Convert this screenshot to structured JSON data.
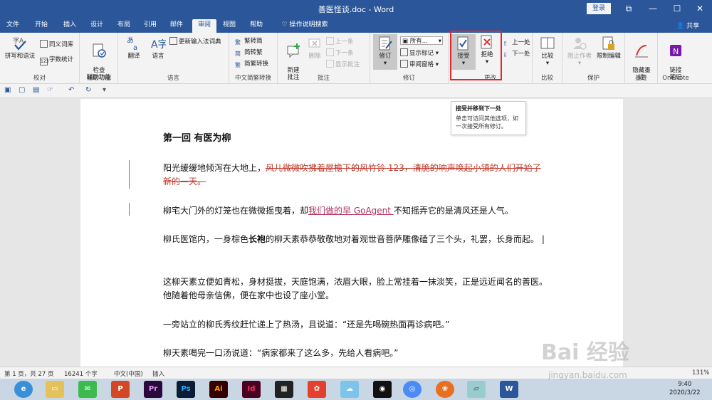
{
  "window": {
    "title": "善医怪谈.doc - Word",
    "login": "登录",
    "share": "共享",
    "controls": [
      "⧉",
      "—",
      "☐",
      "✕"
    ]
  },
  "tabs": [
    "文件",
    "开始",
    "插入",
    "设计",
    "布局",
    "引用",
    "邮件",
    "审阅",
    "视图",
    "帮助",
    "操作说明搜索"
  ],
  "active_tab": "审阅",
  "ribbon": {
    "proofing": {
      "label": "校对",
      "spell": "拼写和语法",
      "thesaurus": "同义词库",
      "wordcount": "字数统计"
    },
    "accessibility": {
      "label": "辅助功能",
      "check": "检查\n辅助功能"
    },
    "language": {
      "label": "语言",
      "translate": "翻译",
      "language": "语言",
      "update_ime": "更新输入法词典"
    },
    "chinese": {
      "label": "中文简繁转换",
      "to_simp": "繁转简",
      "to_trad": "简转繁",
      "convert": "简繁转换"
    },
    "comments": {
      "label": "批注",
      "new": "新建\n批注",
      "delete": "删除",
      "prev": "上一条",
      "next": "下一条",
      "show": "显示批注"
    },
    "tracking": {
      "label": "修订",
      "track": "修订",
      "all_markup": "所有...",
      "show_markup": "显示标记",
      "pane": "审阅窗格"
    },
    "changes": {
      "label": "更改",
      "accept": "接受",
      "reject": "拒绝",
      "prev": "上一处",
      "next": "下一处"
    },
    "compare": {
      "label": "比较",
      "compare": "比较"
    },
    "protect": {
      "label": "保护",
      "block": "阻止作者",
      "restrict": "限制编辑"
    },
    "ink": {
      "label": "墨迹",
      "hide": "隐藏墨\n迹"
    },
    "onenote": {
      "label": "OneNote",
      "link": "链接\n笔记"
    }
  },
  "tooltip": {
    "title": "接受并移到下一处",
    "body": "单击可访问其他选项，如一次接受所有修订。"
  },
  "document": {
    "heading": "第一回  有医为柳",
    "p1_normal": "阳光缓缓地倾泻在大地上，",
    "p1_deleted": "风儿微微吹拂着屋檐下的风竹铃 123，清脆的响声唤起小镇的人们开始了新的一天。",
    "p2_before": "柳宅大门外的灯笼也在微微摇曳着，却",
    "p2_inserted": "我们做的早 GoAgent ",
    "p2_after": "不知摇弄它的是清风还是人气。",
    "p3_before": "柳氏医馆内，一身棕色",
    "p3_bold": "长袍",
    "p3_after": "的柳天素恭恭敬敬地对着观世音菩萨雕像磕了三个头，礼罢，长身而起。",
    "p4": "这柳天素立便如青松，身材挺拔，天庭饱满，浓眉大眼，脸上常挂着一抹淡笑，正是远近闻名的善医。他随着他母亲信佛，便在家中也设了座小堂。",
    "p5": "一旁站立的柳氏秀纹赶忙递上了热汤，且说道：“还是先喝碗热面再诊病吧。”",
    "p6": "柳天素喝完一口汤说道：“病家都来了这么多，先给人看病吧。”"
  },
  "status": {
    "page": "第 1 页，共 27 页",
    "words": "16241 个字",
    "lang": "中文(中国)",
    "mode": "插入",
    "zoom": "131%"
  },
  "taskbar": {
    "time": "9:40",
    "date": "2020/3/22",
    "apps": [
      "PowerPoint",
      "Premiere",
      "Photoshop",
      "Illustrator",
      "InDesign",
      "Word"
    ]
  },
  "watermark": {
    "logo": "Bai 经验",
    "url": "jingyan.baidu.com"
  },
  "colors": {
    "word_blue": "#2b579a",
    "deleted": "#c0392b",
    "inserted": "#b03060",
    "highlight_box": "#e8232a"
  }
}
